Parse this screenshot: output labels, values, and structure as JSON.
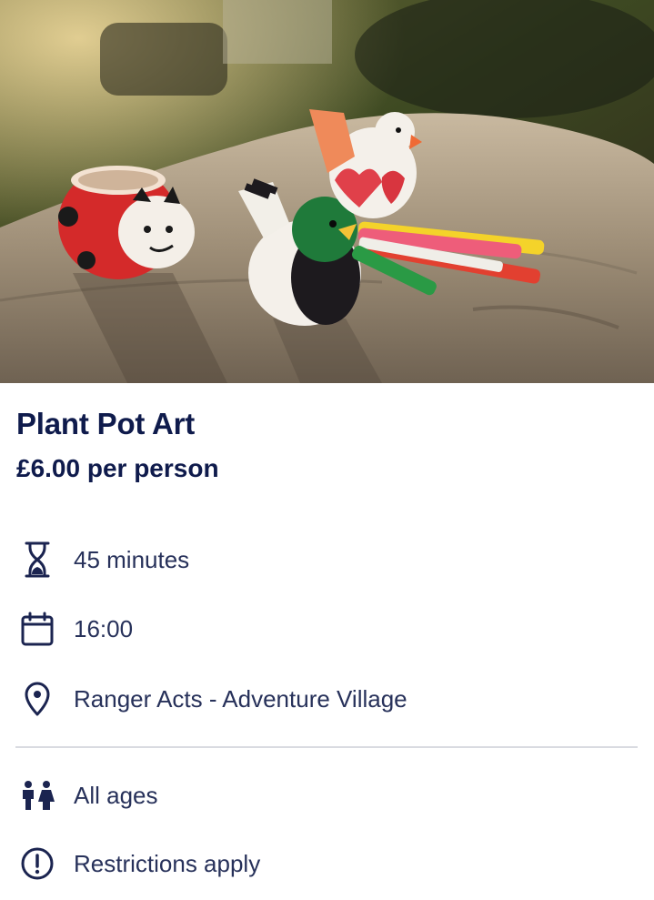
{
  "hero": {
    "image_icon": "activity-photo"
  },
  "activity": {
    "title": "Plant Pot Art",
    "price": "£6.00 per person"
  },
  "details": {
    "duration": {
      "icon": "hourglass-icon",
      "text": "45 minutes"
    },
    "time": {
      "icon": "calendar-icon",
      "text": "16:00"
    },
    "location": {
      "icon": "location-pin-icon",
      "text": "Ranger Acts - Adventure Village"
    },
    "ages": {
      "icon": "children-icon",
      "text": "All ages"
    },
    "restrictions": {
      "icon": "alert-circle-icon",
      "text": "Restrictions apply"
    }
  },
  "colors": {
    "primary_text": "#0f1b4c",
    "body_text": "#27315a",
    "divider": "#d9dbe1"
  }
}
